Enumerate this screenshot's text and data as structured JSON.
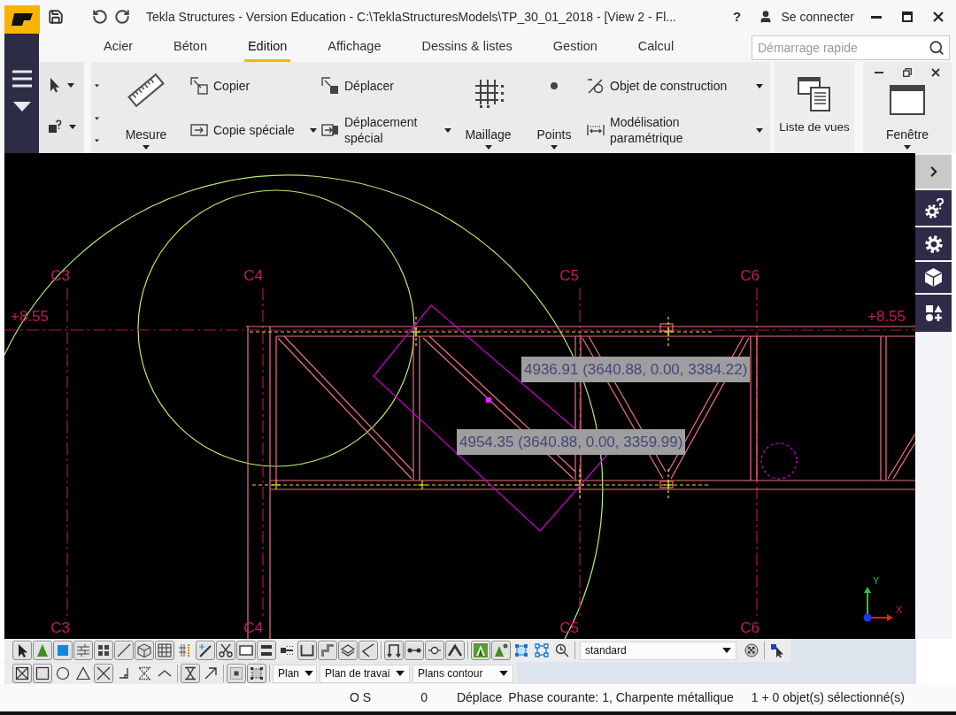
{
  "window": {
    "title": "Tekla Structures - Version Education - C:\\TeklaStructuresModels\\TP_30_01_2018 - [View 2 - Fl...",
    "help": "?",
    "account": "Se connecter"
  },
  "tabs": [
    {
      "label": "Acier",
      "selected": false
    },
    {
      "label": "Béton",
      "selected": false
    },
    {
      "label": "Edition",
      "selected": true
    },
    {
      "label": "Affichage",
      "selected": false
    },
    {
      "label": "Dessins & listes",
      "selected": false
    },
    {
      "label": "Gestion",
      "selected": false
    },
    {
      "label": "Calcul",
      "selected": false
    }
  ],
  "quick_launch": {
    "placeholder": "Démarrage rapide"
  },
  "ribbon": {
    "measure": "Mesure",
    "copy": "Copier",
    "copy_special": "Copie spéciale",
    "move": "Déplacer",
    "move_special": "Déplacement spécial",
    "grid": "Maillage",
    "points": "Points",
    "construction_object": "Objet de construction",
    "parametric_modeling": "Modélisation paramétrique",
    "view_list": "Liste de vues",
    "window": "Fenêtre"
  },
  "viewport": {
    "grid_labels_top": [
      "C3",
      "C4",
      "C5",
      "C6"
    ],
    "grid_labels_bottom": [
      "C3",
      "C4",
      "C5",
      "C6"
    ],
    "level_labels": [
      "+8.55",
      "+8.55"
    ],
    "measurements": [
      "4936.91 (3640.88, 0.00, 3384.22)",
      "4954.35 (3640.88, 0.00, 3359.99)"
    ],
    "axis_labels": [
      "Y",
      "X"
    ]
  },
  "selection_toolbar": {
    "groups": [
      [
        {
          "kind": "pointer",
          "on": true
        },
        {
          "kind": "triangle-green",
          "on": true
        },
        {
          "kind": "square-blue",
          "on": true
        },
        {
          "kind": "brick",
          "on": true
        },
        {
          "kind": "dots",
          "on": true
        },
        {
          "kind": "line",
          "on": true
        },
        {
          "kind": "cube",
          "on": true
        },
        {
          "kind": "grid",
          "on": true
        },
        {
          "kind": "grid-dotted",
          "on": false
        },
        {
          "kind": "wand",
          "on": true
        },
        {
          "kind": "scissors",
          "on": true
        },
        {
          "kind": "rectangle",
          "on": true
        },
        {
          "kind": "bars",
          "on": true
        },
        {
          "kind": "bar-dots",
          "on": false
        },
        {
          "kind": "channel",
          "on": true
        },
        {
          "kind": "step",
          "on": true
        },
        {
          "kind": "layers",
          "on": true
        },
        {
          "kind": "angle",
          "on": true
        }
      ],
      [
        {
          "kind": "frame-arrows",
          "on": true
        },
        {
          "kind": "line-dots",
          "on": true
        },
        {
          "kind": "line-circle",
          "on": true
        },
        {
          "kind": "roof",
          "on": true
        }
      ],
      [
        {
          "kind": "triangle-tile",
          "on": true
        },
        {
          "kind": "triangle-dot",
          "on": true
        },
        {
          "kind": "frame-blue",
          "on": false
        },
        {
          "kind": "corners-blue",
          "on": false
        },
        {
          "kind": "clock-search",
          "on": false
        }
      ]
    ],
    "filter": "standard",
    "trailing_groups": [
      [
        {
          "kind": "checker",
          "on": false
        }
      ],
      [
        {
          "kind": "pointer-square",
          "on": false
        }
      ]
    ]
  },
  "snap_toolbar": {
    "groups": [
      [
        {
          "kind": "box-x",
          "on": true
        },
        {
          "kind": "square",
          "on": true
        },
        {
          "kind": "circle",
          "on": false
        },
        {
          "kind": "triangle",
          "on": false
        },
        {
          "kind": "x",
          "on": true
        },
        {
          "kind": "perpendicular",
          "on": false
        },
        {
          "kind": "hourglass-dotted",
          "on": false
        },
        {
          "kind": "chevron",
          "on": false
        }
      ],
      [
        {
          "kind": "hourglass",
          "on": true
        },
        {
          "kind": "arrow",
          "on": false
        }
      ],
      [
        {
          "kind": "square-filled",
          "on": true
        },
        {
          "kind": "square-dashed",
          "on": true
        }
      ]
    ],
    "planes": [
      "Plan",
      "Plan de travai",
      "Plans contour"
    ]
  },
  "status_bar": {
    "snap_mode": "O S",
    "count": "0",
    "command": "Déplace",
    "phase": "Phase courante: 1, Charpente métallique",
    "selection": "1 + 0 objet(s) sélectionné(s)"
  }
}
